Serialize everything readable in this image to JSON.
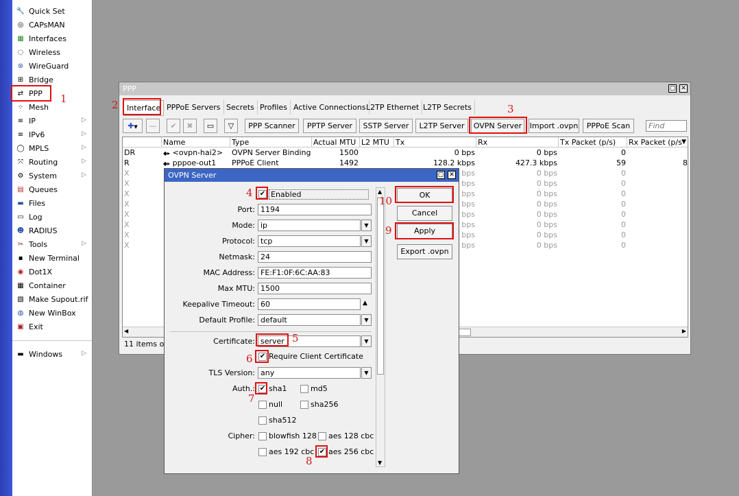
{
  "sidebar": {
    "items": [
      {
        "label": "Quick Set",
        "icon": "quick-set-icon",
        "glyph": "🔧"
      },
      {
        "label": "CAPsMAN",
        "icon": "capsman-icon",
        "glyph": "◎"
      },
      {
        "label": "Interfaces",
        "icon": "interfaces-icon",
        "glyph": "▦"
      },
      {
        "label": "Wireless",
        "icon": "wireless-icon",
        "glyph": "◌"
      },
      {
        "label": "WireGuard",
        "icon": "wireguard-icon",
        "glyph": "⊛"
      },
      {
        "label": "Bridge",
        "icon": "bridge-icon",
        "glyph": "⊞"
      },
      {
        "label": "PPP",
        "icon": "ppp-icon",
        "glyph": "⇄"
      },
      {
        "label": "Mesh",
        "icon": "mesh-icon",
        "glyph": "⁘"
      },
      {
        "label": "IP",
        "icon": "ip-icon",
        "glyph": "≡"
      },
      {
        "label": "IPv6",
        "icon": "ipv6-icon",
        "glyph": "≡"
      },
      {
        "label": "MPLS",
        "icon": "mpls-icon",
        "glyph": "◯"
      },
      {
        "label": "Routing",
        "icon": "routing-icon",
        "glyph": "⤧"
      },
      {
        "label": "System",
        "icon": "system-icon",
        "glyph": "⚙"
      },
      {
        "label": "Queues",
        "icon": "queues-icon",
        "glyph": "▤"
      },
      {
        "label": "Files",
        "icon": "files-icon",
        "glyph": "▬"
      },
      {
        "label": "Log",
        "icon": "log-icon",
        "glyph": "▭"
      },
      {
        "label": "RADIUS",
        "icon": "radius-icon",
        "glyph": "☻"
      },
      {
        "label": "Tools",
        "icon": "tools-icon",
        "glyph": "✂"
      },
      {
        "label": "New Terminal",
        "icon": "terminal-icon",
        "glyph": "▪"
      },
      {
        "label": "Dot1X",
        "icon": "dot1x-icon",
        "glyph": "◉"
      },
      {
        "label": "Container",
        "icon": "container-icon",
        "glyph": "▦"
      },
      {
        "label": "Make Supout.rif",
        "icon": "supout-icon",
        "glyph": "▧"
      },
      {
        "label": "New WinBox",
        "icon": "winbox-icon",
        "glyph": "◍"
      },
      {
        "label": "Exit",
        "icon": "exit-icon",
        "glyph": "▣"
      },
      {
        "label": "Windows",
        "icon": "windows-icon",
        "glyph": "▬"
      }
    ],
    "submenu_glyph": "▷"
  },
  "ppp_window": {
    "title": "PPP",
    "tabs": [
      "Interface",
      "PPPoE Servers",
      "Secrets",
      "Profiles",
      "Active Connections",
      "L2TP Ethernet",
      "L2TP Secrets"
    ],
    "toolbar": {
      "add": "✚",
      "remove": "—",
      "enable": "✔",
      "disable": "✖",
      "comment": "▭",
      "filter": "▽",
      "buttons": [
        "PPP Scanner",
        "PPTP Server",
        "SSTP Server",
        "L2TP Server",
        "OVPN Server",
        "Import .ovpn",
        "PPPoE Scan"
      ],
      "find_placeholder": "Find"
    },
    "columns": [
      "Name",
      "Type",
      "Actual MTU",
      "L2 MTU",
      "Tx",
      "Rx",
      "Tx Packet (p/s)",
      "Rx Packet (p/s"
    ],
    "rows": [
      {
        "flag": "DR",
        "name": "<ovpn-hai2>",
        "type": "OVPN Server Binding",
        "mtu": "1500",
        "l2mtu": "",
        "tx": "0 bps",
        "rx": "0 bps",
        "txp": "0",
        "rxp": ""
      },
      {
        "flag": "R",
        "name": "pppoe-out1",
        "type": "PPPoE Client",
        "mtu": "1492",
        "l2mtu": "",
        "tx": "128.2 kbps",
        "rx": "427.3 kbps",
        "txp": "59",
        "rxp": "8"
      },
      {
        "flag": "X",
        "tx": "bps",
        "rx": "0 bps",
        "txp": "0"
      },
      {
        "flag": "X",
        "tx": "bps",
        "rx": "0 bps",
        "txp": "0"
      },
      {
        "flag": "X",
        "tx": "bps",
        "rx": "0 bps",
        "txp": "0"
      },
      {
        "flag": "X",
        "tx": "bps",
        "rx": "0 bps",
        "txp": "0"
      },
      {
        "flag": "X",
        "tx": "bps",
        "rx": "0 bps",
        "txp": "0"
      },
      {
        "flag": "X",
        "tx": "bps",
        "rx": "0 bps",
        "txp": "0"
      },
      {
        "flag": "X",
        "tx": "bps",
        "rx": "0 bps",
        "txp": "0"
      },
      {
        "flag": "X",
        "tx": "bps",
        "rx": "0 bps",
        "txp": "0"
      }
    ],
    "status": "11 items out"
  },
  "ovpn_dialog": {
    "title": "OVPN Server",
    "enabled_label": "Enabled",
    "fields": {
      "port": {
        "label": "Port:",
        "value": "1194"
      },
      "mode": {
        "label": "Mode:",
        "value": "ip"
      },
      "protocol": {
        "label": "Protocol:",
        "value": "tcp"
      },
      "netmask": {
        "label": "Netmask:",
        "value": "24"
      },
      "mac": {
        "label": "MAC Address:",
        "value": "FE:F1:0F:6C:AA:83"
      },
      "maxmtu": {
        "label": "Max MTU:",
        "value": "1500"
      },
      "keepalive": {
        "label": "Keepalive Timeout:",
        "value": "60"
      },
      "profile": {
        "label": "Default Profile:",
        "value": "default"
      },
      "certificate": {
        "label": "Certificate:",
        "value": "server"
      },
      "tls": {
        "label": "TLS Version:",
        "value": "any"
      }
    },
    "require_cert_label": "Require Client Certificate",
    "auth_label": "Auth.:",
    "auth": {
      "sha1": "sha1",
      "md5": "md5",
      "null": "null",
      "sha256": "sha256",
      "sha512": "sha512"
    },
    "cipher_label": "Cipher:",
    "cipher": {
      "blowfish": "blowfish 128",
      "aes128": "aes 128 cbc",
      "aes192": "aes 192 cbc",
      "aes256": "aes 256 cbc"
    },
    "buttons": {
      "ok": "OK",
      "cancel": "Cancel",
      "apply": "Apply",
      "export": "Export .ovpn"
    }
  },
  "annotations": {
    "n1": "1",
    "n2": "2",
    "n3": "3",
    "n4": "4",
    "n5": "5",
    "n6": "6",
    "n7": "7",
    "n8": "8",
    "n9": "9",
    "n10": "10"
  },
  "glyphs": {
    "check": "✔",
    "down": "▼",
    "up": "▲",
    "left": "◀",
    "right": "▶",
    "minimize": "▢",
    "close": "✕"
  },
  "colors": {
    "titlebar_active": "#3c66c4",
    "titlebar_inactive": "#c8c8c8",
    "annotation": "#e01010",
    "sidebar_strip": "#3d56d6"
  }
}
